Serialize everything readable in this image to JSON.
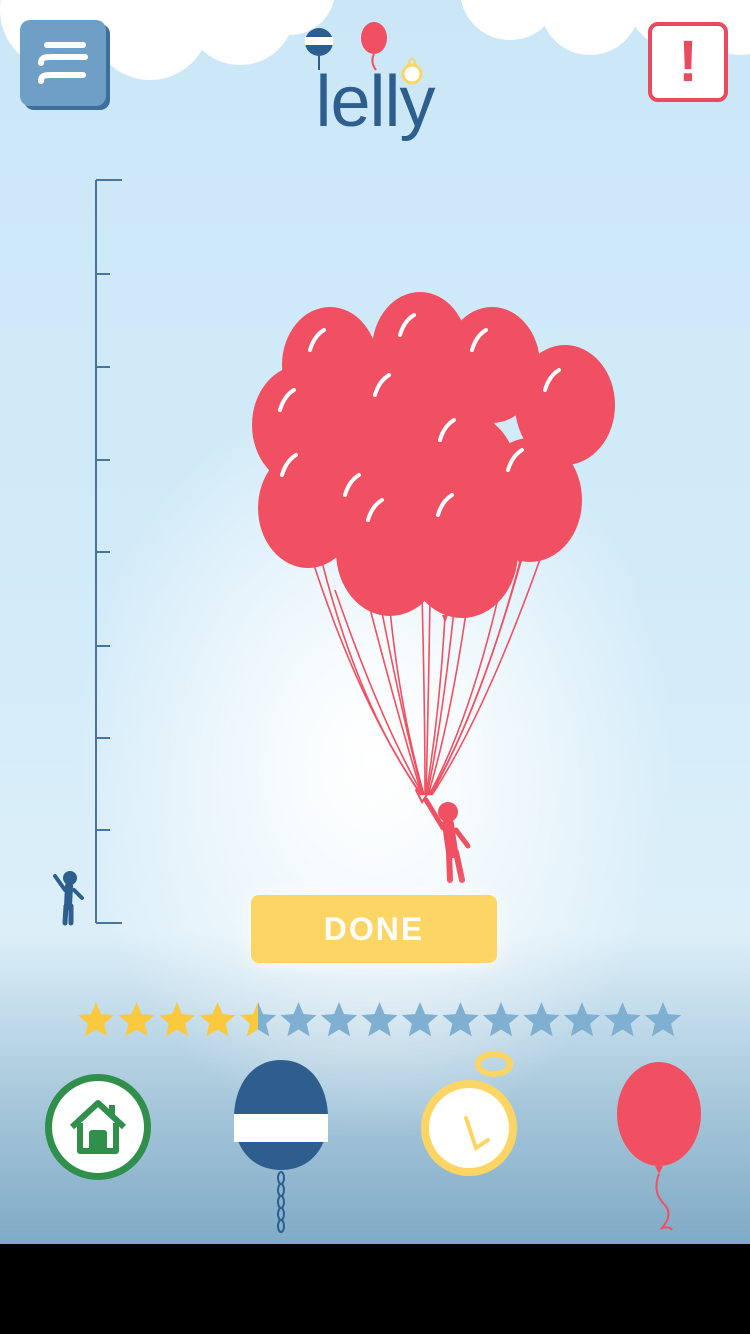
{
  "app": {
    "logo_text": "lelly"
  },
  "header": {
    "menu_icon": "menu-icon",
    "alert_label": "!"
  },
  "main": {
    "done_label": "DONE",
    "balloon_count": 15
  },
  "rating": {
    "total_stars": 15,
    "filled_stars": 4.5
  },
  "toolbar": {
    "items": [
      {
        "name": "home",
        "icon": "home-icon"
      },
      {
        "name": "weight",
        "icon": "buoy-weight-icon"
      },
      {
        "name": "timer",
        "icon": "stopwatch-icon"
      },
      {
        "name": "balloon",
        "icon": "balloon-icon"
      }
    ]
  },
  "colors": {
    "balloon": "#f05062",
    "navy": "#2e5e8e",
    "done": "#fdd565",
    "star_filled": "#fbc93d",
    "star_empty": "#7fafd1",
    "home_green": "#2f8f4b"
  }
}
